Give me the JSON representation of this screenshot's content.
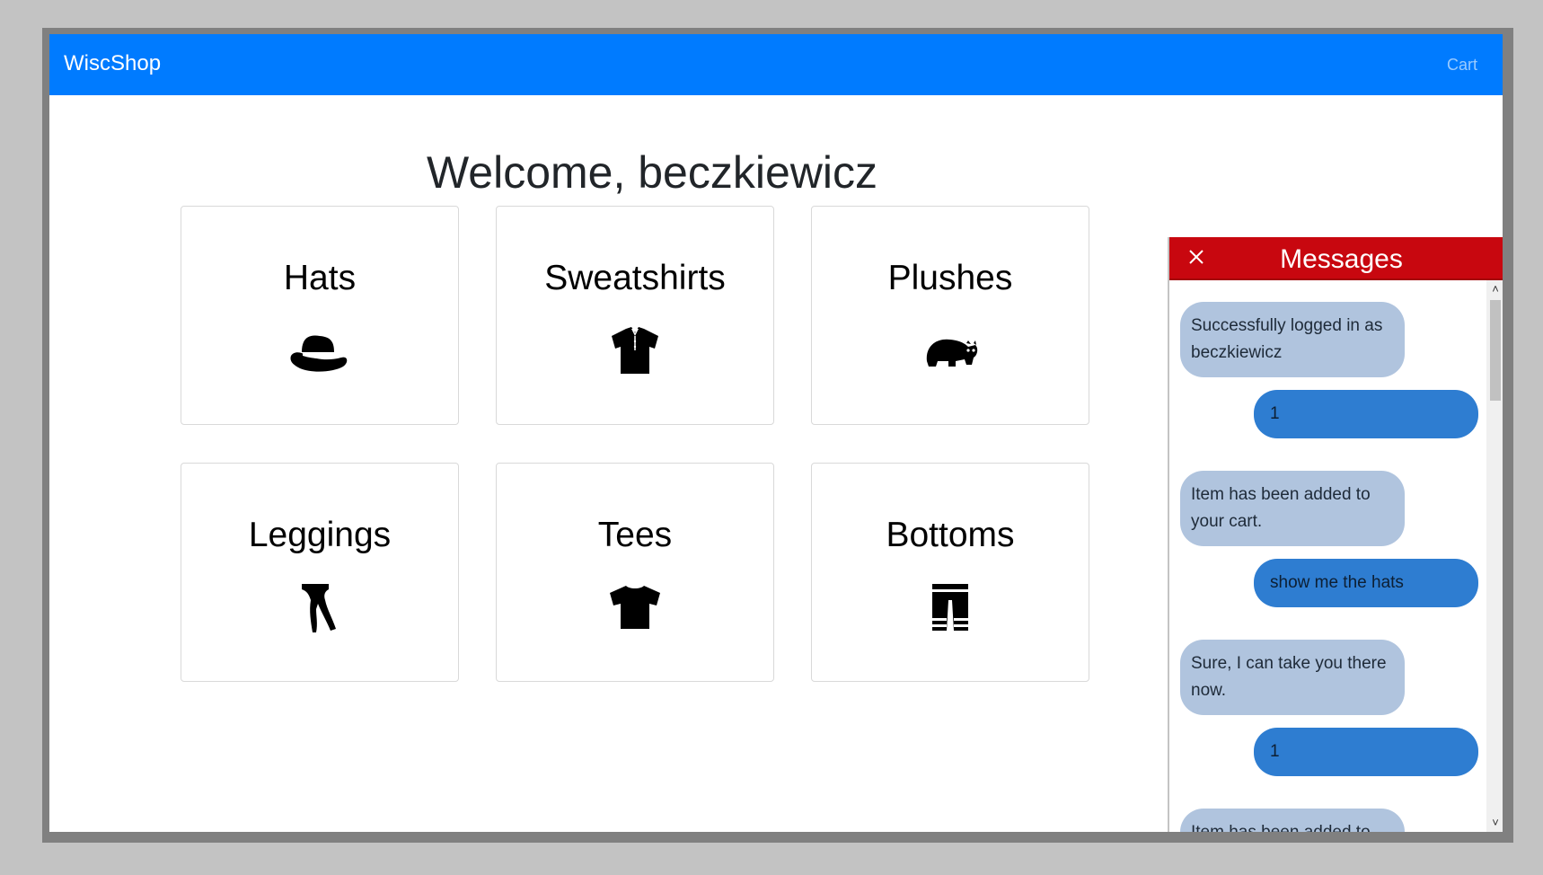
{
  "navbar": {
    "brand": "WiscShop",
    "cart_label": "Cart"
  },
  "welcome": "Welcome, beczkiewicz",
  "categories": [
    {
      "label": "Hats",
      "icon": "hat-icon"
    },
    {
      "label": "Sweatshirts",
      "icon": "sweatshirt-icon"
    },
    {
      "label": "Plushes",
      "icon": "bear-plush-icon"
    },
    {
      "label": "Leggings",
      "icon": "leggings-icon"
    },
    {
      "label": "Tees",
      "icon": "tshirt-icon"
    },
    {
      "label": "Bottoms",
      "icon": "pants-icon"
    }
  ],
  "chat": {
    "title": "Messages",
    "header_color": "#c8070f",
    "messages": [
      {
        "from": "bot",
        "text": "Successfully logged in as beczkiewicz"
      },
      {
        "from": "user",
        "text": "1"
      },
      {
        "from": "bot",
        "text": "Item has been added to your cart."
      },
      {
        "from": "user",
        "text": "show me the hats"
      },
      {
        "from": "bot",
        "text": "Sure, I can take you there now."
      },
      {
        "from": "user",
        "text": "1"
      },
      {
        "from": "bot",
        "text": "Item has been added to"
      }
    ]
  },
  "colors": {
    "navbar": "#007bff",
    "bot_bubble": "#b0c4de",
    "user_bubble": "#2e7dd1"
  }
}
